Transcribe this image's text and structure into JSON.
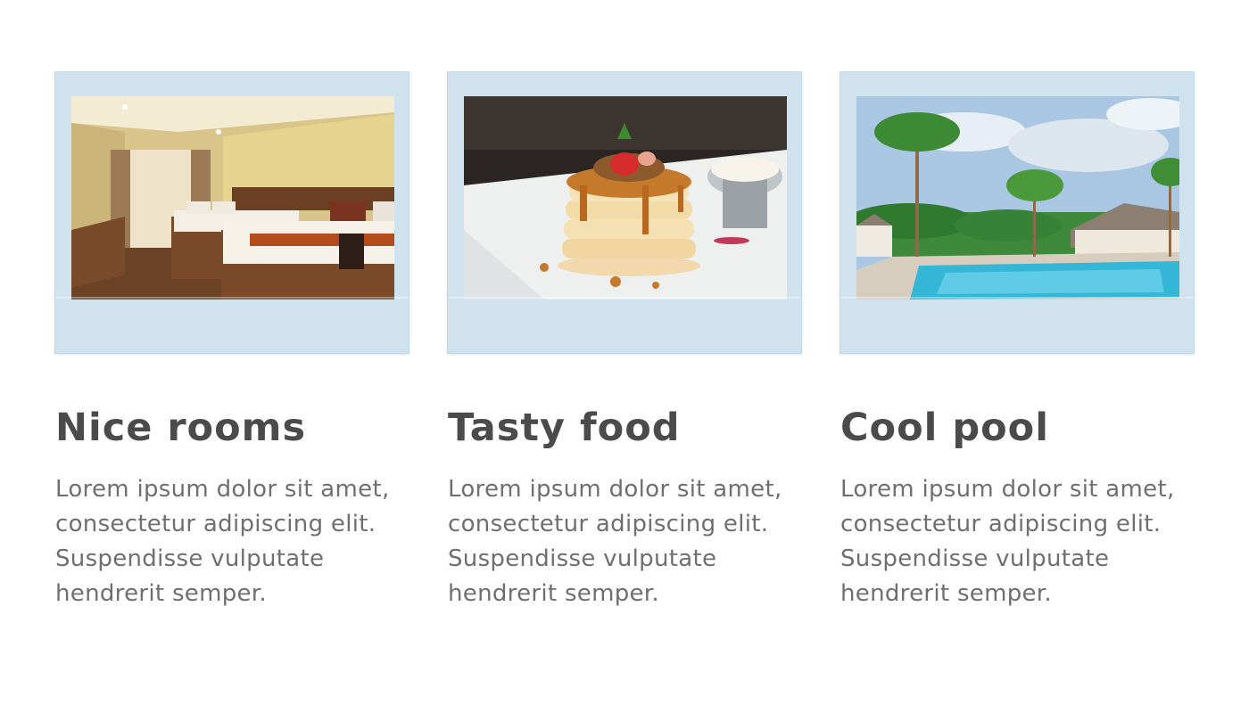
{
  "features": [
    {
      "title": "Nice rooms",
      "body_lines": [
        "Lorem ipsum dolor sit amet,",
        "consectetur adipiscing elit.",
        "Suspendisse vulputate",
        "hendrerit semper."
      ]
    },
    {
      "title": "Tasty food",
      "body_lines": [
        "Lorem ipsum dolor sit amet,",
        "consectetur adipiscing elit.",
        "Suspendisse vulputate",
        "hendrerit semper."
      ]
    },
    {
      "title": "Cool pool",
      "body_lines": [
        "Lorem ipsum dolor sit amet,",
        "consectetur adipiscing elit.",
        "Suspendisse vulputate",
        "hendrerit semper."
      ]
    }
  ],
  "colors": {
    "frame": "#cfe2ee",
    "heading": "#4b4b4b",
    "body_text": "#6f6f6f"
  }
}
